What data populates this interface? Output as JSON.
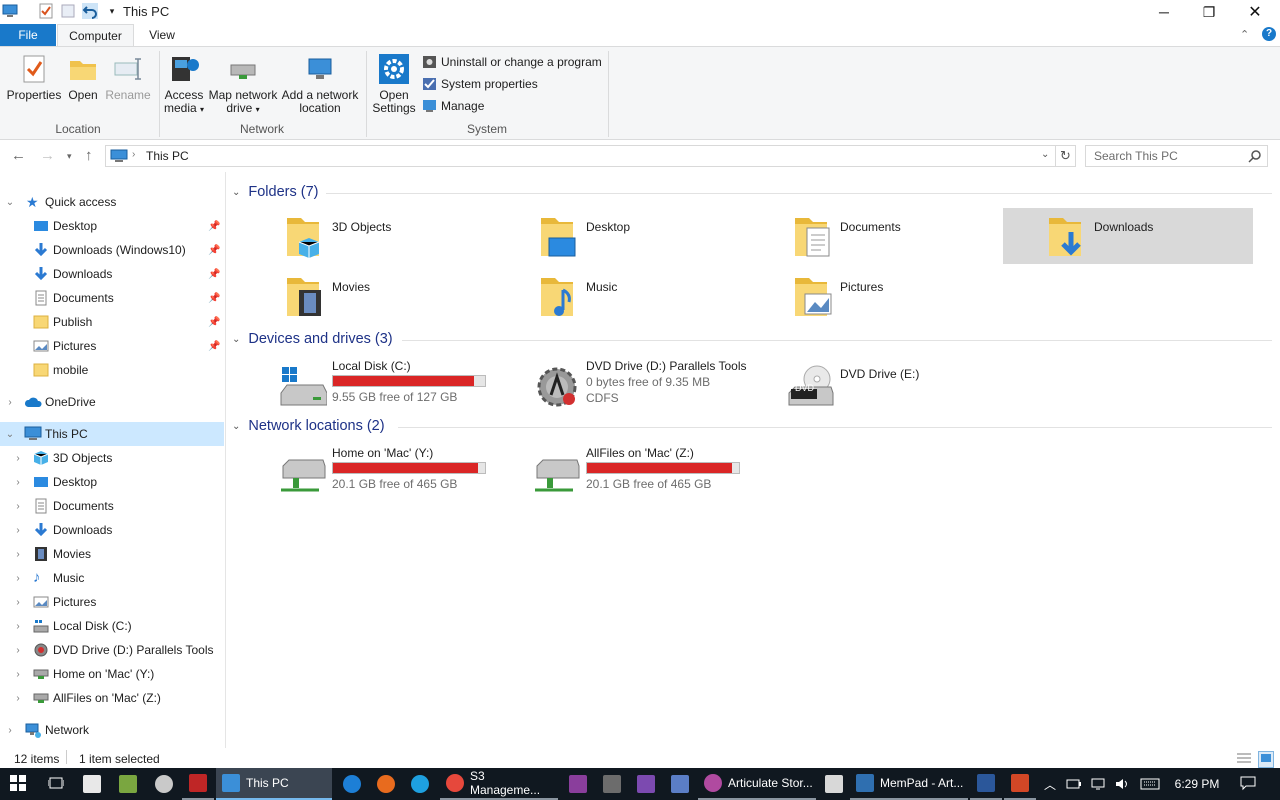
{
  "window": {
    "title": "This PC"
  },
  "ribbon": {
    "tabs": [
      "File",
      "Computer",
      "View"
    ],
    "location": {
      "label": "Location",
      "buttons": [
        "Properties",
        "Open",
        "Rename"
      ]
    },
    "network": {
      "label": "Network",
      "access_media": "Access media",
      "map_drive": "Map network drive",
      "add_location": "Add a network location"
    },
    "system": {
      "label": "System",
      "open_settings": "Open Settings",
      "uninstall": "Uninstall or change a program",
      "system_properties": "System properties",
      "manage": "Manage"
    }
  },
  "address": {
    "path": "This PC",
    "search_placeholder": "Search This PC"
  },
  "nav": {
    "quick_access": {
      "label": "Quick access",
      "items": [
        {
          "label": "Desktop",
          "icon": "desktop-icon",
          "pinned": true
        },
        {
          "label": "Downloads (Windows10)",
          "icon": "downloads-icon",
          "pinned": true
        },
        {
          "label": "Downloads",
          "icon": "downloads-icon",
          "pinned": true
        },
        {
          "label": "Documents",
          "icon": "documents-icon",
          "pinned": true
        },
        {
          "label": "Publish",
          "icon": "folder-icon",
          "pinned": true
        },
        {
          "label": "Pictures",
          "icon": "pictures-icon",
          "pinned": true
        },
        {
          "label": "mobile",
          "icon": "folder-icon",
          "pinned": false
        }
      ]
    },
    "onedrive": "OneDrive",
    "this_pc": {
      "label": "This PC",
      "items": [
        "3D Objects",
        "Desktop",
        "Documents",
        "Downloads",
        "Movies",
        "Music",
        "Pictures",
        "Local Disk (C:)",
        "DVD Drive (D:) Parallels Tools",
        "Home on 'Mac' (Y:)",
        "AllFiles on 'Mac' (Z:)"
      ]
    },
    "network": "Network"
  },
  "content": {
    "folders": {
      "header": "Folders (7)",
      "items": [
        "3D Objects",
        "Desktop",
        "Documents",
        "Downloads",
        "Movies",
        "Music",
        "Pictures"
      ],
      "selected": "Downloads"
    },
    "devices": {
      "header": "Devices and drives (3)",
      "items": [
        {
          "name": "Local Disk (C:)",
          "detail": "9.55 GB free of 127 GB",
          "used_fraction": 0.925
        },
        {
          "name": "DVD Drive (D:) Parallels Tools",
          "detail": "0 bytes free of 9.35 MB",
          "detail2": "CDFS"
        },
        {
          "name": "DVD Drive (E:)",
          "badge": "DVD"
        }
      ]
    },
    "network_locations": {
      "header": "Network locations (2)",
      "items": [
        {
          "name": "Home on 'Mac' (Y:)",
          "detail": "20.1 GB free of 465 GB",
          "used_fraction": 0.957
        },
        {
          "name": "AllFiles on 'Mac' (Z:)",
          "detail": "20.1 GB free of 465 GB",
          "used_fraction": 0.957
        }
      ]
    }
  },
  "status": {
    "items": "12 items",
    "selected": "1 item selected"
  },
  "taskbar": {
    "explorer": "This PC",
    "chrome": "S3 Manageme...",
    "articulate": "Articulate Stor...",
    "mempad": "MemPad - Art...",
    "clock": "6:29 PM"
  },
  "colors": {
    "accent": "#1979ca",
    "selection": "#cce8ff",
    "drive_bar": "#da2626",
    "taskbar": "#101820",
    "header": "#1e3287"
  }
}
